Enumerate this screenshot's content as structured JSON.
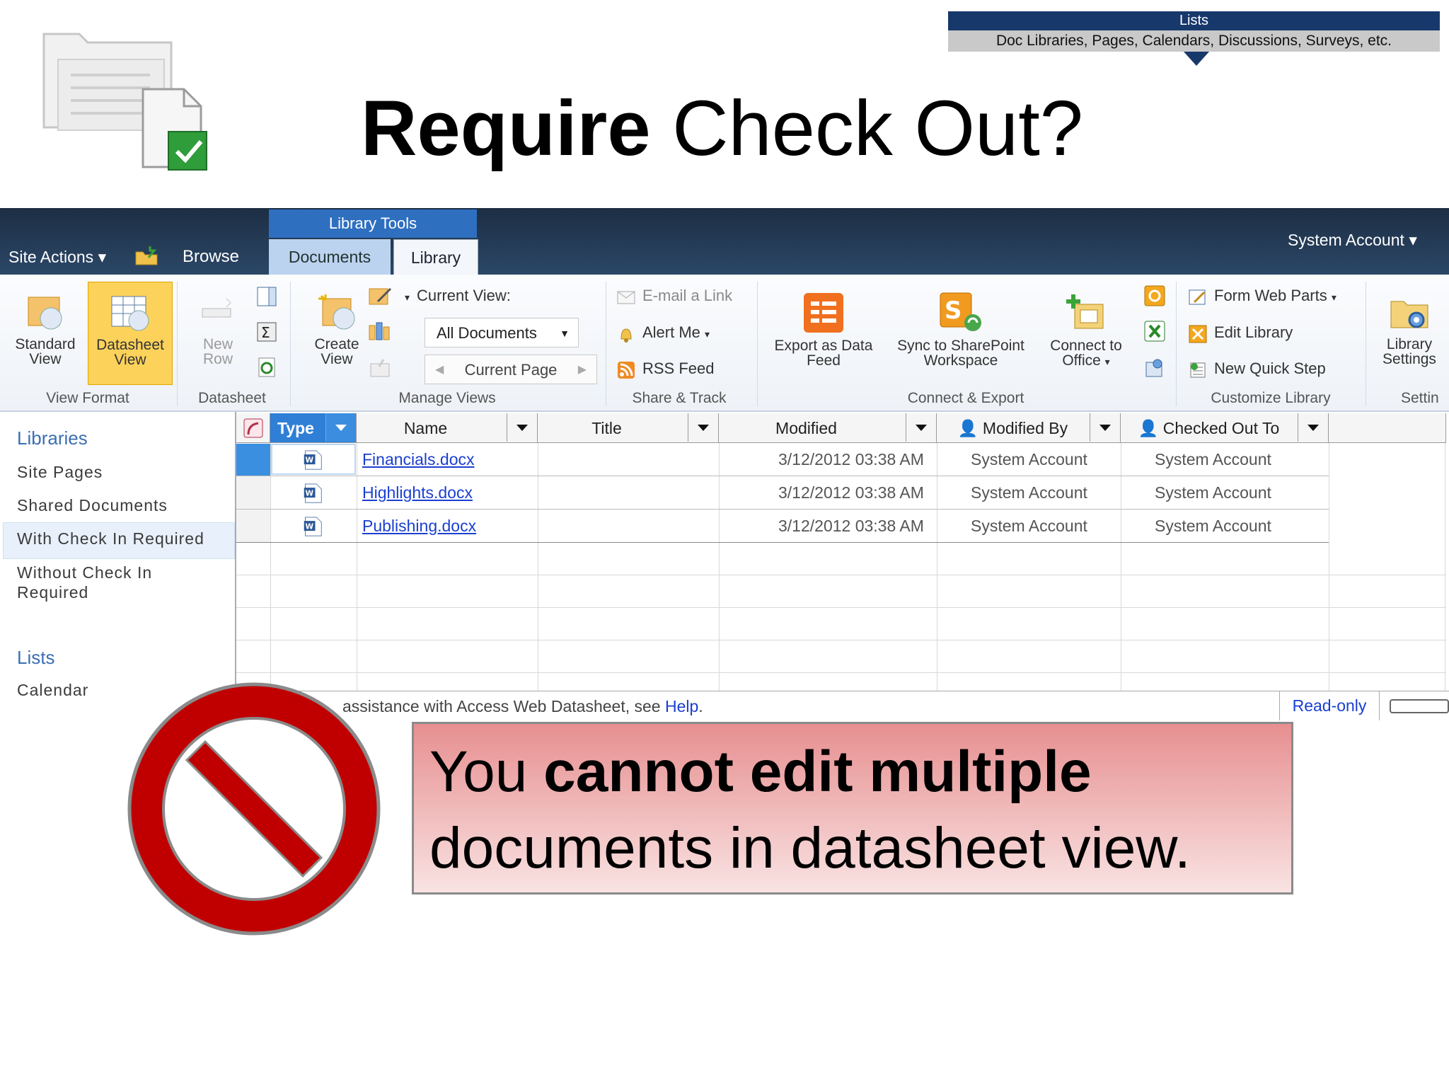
{
  "lists_banner": {
    "title": "Lists",
    "subtitle": "Doc Libraries, Pages, Calendars, Discussions, Surveys, etc."
  },
  "slide": {
    "title_bold": "Require",
    "title_rest": " Check Out?"
  },
  "ribbon": {
    "site_actions": "Site Actions",
    "browse": "Browse",
    "tab_group": "Library Tools",
    "tabs": [
      "Documents",
      "Library"
    ],
    "account": "System Account",
    "groups": {
      "view_format": {
        "label": "View Format",
        "standard_view": [
          "Standard",
          "View"
        ],
        "datasheet_view": [
          "Datasheet",
          "View"
        ]
      },
      "datasheet": {
        "label": "Datasheet",
        "new_row": [
          "New",
          "Row"
        ]
      },
      "manage_views": {
        "label": "Manage Views",
        "create_view": [
          "Create",
          "View"
        ],
        "current_view_label": "Current View:",
        "current_view_value": "All Documents",
        "current_page": "Current Page"
      },
      "share_track": {
        "label": "Share & Track",
        "items": [
          "E-mail a Link",
          "Alert Me",
          "RSS Feed"
        ]
      },
      "connect_export": {
        "label": "Connect & Export",
        "export": [
          "Export as Data",
          "Feed"
        ],
        "sync": [
          "Sync to SharePoint",
          "Workspace"
        ],
        "connect": [
          "Connect to",
          "Office"
        ]
      },
      "customize_library": {
        "label": "Customize Library",
        "items": [
          "Form Web Parts",
          "Edit Library",
          "New Quick Step"
        ]
      },
      "settings": {
        "label": "Settin",
        "library_settings": [
          "Library",
          "Settings"
        ]
      }
    }
  },
  "leftnav": {
    "libraries_heading": "Libraries",
    "library_items": [
      "Site Pages",
      "Shared Documents",
      "With Check In Required",
      "Without Check In",
      "Required"
    ],
    "lists_heading": "Lists",
    "list_items": [
      "Calendar"
    ]
  },
  "datasheet": {
    "columns": [
      "Type",
      "Name",
      "Title",
      "Modified",
      "Modified By",
      "Checked Out To"
    ],
    "rows": [
      {
        "name": "Financials.docx",
        "title": "",
        "modified": "3/12/2012 03:38 AM",
        "modified_by": "System Account",
        "checked_out_to": "System Account"
      },
      {
        "name": "Highlights.docx",
        "title": "",
        "modified": "3/12/2012 03:38 AM",
        "modified_by": "System Account",
        "checked_out_to": "System Account"
      },
      {
        "name": "Publishing.docx",
        "title": "",
        "modified": "3/12/2012 03:38 AM",
        "modified_by": "System Account",
        "checked_out_to": "System Account"
      }
    ],
    "status_text": "assistance with Access Web Datasheet, see ",
    "help_link": "Help",
    "status_end": ".",
    "readonly": "Read-only"
  },
  "callout": {
    "part1": "You ",
    "part2_bold": "cannot edit multiple",
    "part3": "documents in datasheet view."
  },
  "colors": {
    "ribbon_dark": "#243b55",
    "tab_group": "#2f6fc0",
    "active_button": "#fcd25a",
    "link": "#1a3fd1",
    "no_sign_red": "#c00000"
  }
}
